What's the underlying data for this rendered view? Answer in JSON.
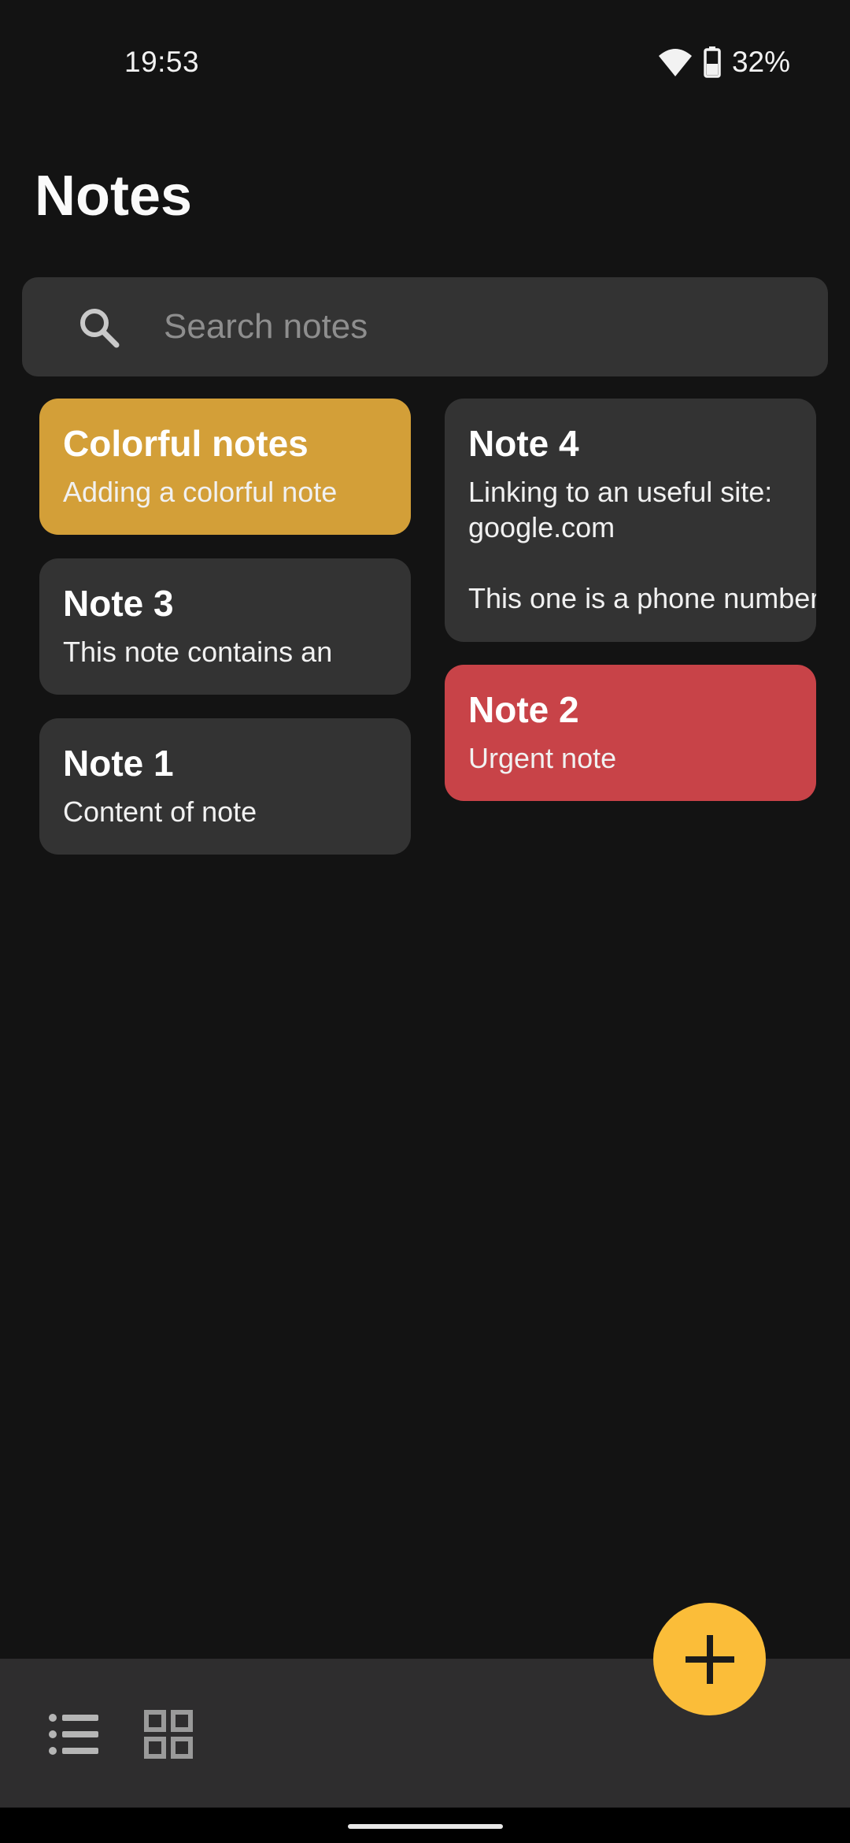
{
  "status_bar": {
    "time": "19:53",
    "battery_percent": "32%",
    "icons": [
      "wifi-icon",
      "battery-icon"
    ]
  },
  "header": {
    "title": "Notes"
  },
  "search": {
    "placeholder": "Search notes",
    "value": ""
  },
  "notes": [
    {
      "id": "colorful",
      "title": "Colorful notes",
      "body": "Adding a colorful note",
      "color": "#d39f38"
    },
    {
      "id": "note4",
      "title": "Note 4",
      "body": "Linking to an useful site:\ngoogle.com\n\nThis one is a phone number",
      "color": "#333333"
    },
    {
      "id": "note3",
      "title": "Note 3",
      "body": "This note contains an",
      "color": "#333333"
    },
    {
      "id": "note2",
      "title": "Note 2",
      "body": "Urgent note",
      "color": "#c84348"
    },
    {
      "id": "note1",
      "title": "Note 1",
      "body": "Content of note",
      "color": "#333333"
    }
  ],
  "bottom_bar": {
    "buttons": [
      "list-view-icon",
      "grid-view-icon"
    ],
    "fab_icon": "add-icon",
    "fab_color": "#fbbd39"
  },
  "colors": {
    "background": "#131313",
    "card": "#333333",
    "search_bg": "#333333",
    "bottom_bar": "#2e2d2e"
  }
}
